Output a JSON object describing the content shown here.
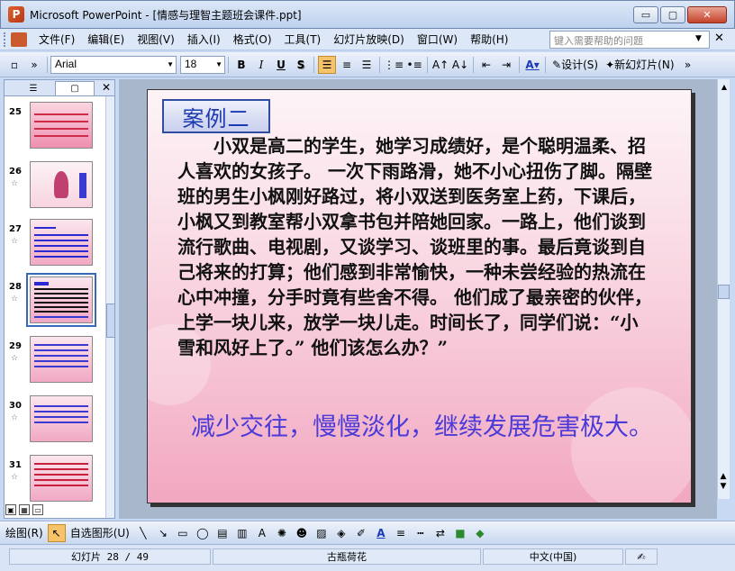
{
  "window": {
    "title": "Microsoft PowerPoint - [情感与理智主题班会课件.ppt]",
    "app_icon_letter": "P",
    "minimize_label": "▭",
    "restore_label": "▢",
    "close_label": "✕"
  },
  "menubar": {
    "items": [
      "文件(F)",
      "编辑(E)",
      "视图(V)",
      "插入(I)",
      "格式(O)",
      "工具(T)",
      "幻灯片放映(D)",
      "窗口(W)",
      "帮助(H)"
    ],
    "help_placeholder": "键入需要帮助的问题",
    "close_label": "✕"
  },
  "toolbar": {
    "font_name": "Arial",
    "font_size": "18",
    "bold": "B",
    "italic": "I",
    "underline": "U",
    "shadow": "S",
    "design_label": "设计(S)",
    "new_slide_label": "新幻灯片(N)"
  },
  "left_pane": {
    "tab_outline": "☰",
    "tab_slides": "▢",
    "close_label": "✕",
    "thumbnails": [
      {
        "num": "25",
        "star": "",
        "style": "pink-dots"
      },
      {
        "num": "26",
        "star": "☆",
        "style": "flowers"
      },
      {
        "num": "27",
        "star": "☆",
        "style": "blue-text"
      },
      {
        "num": "28",
        "star": "☆",
        "style": "blue-text",
        "selected": true
      },
      {
        "num": "29",
        "star": "☆",
        "style": "pink-text"
      },
      {
        "num": "30",
        "star": "☆",
        "style": "pink-text"
      },
      {
        "num": "31",
        "star": "☆",
        "style": "red-text"
      }
    ]
  },
  "slide": {
    "title": "案例二",
    "body": "小双是高二的学生，她学习成绩好，是个聪明温柔、招人喜欢的女孩子。 一次下雨路滑，她不小心扭伤了脚。隔壁班的男生小枫刚好路过，将小双送到医务室上药，下课后，小枫又到教室帮小双拿书包并陪她回家。一路上，他们谈到流行歌曲、电视剧，又谈学习、谈班里的事。最后竟谈到自己将来的打算；他们感到非常愉快，一种未尝经验的热流在心中冲撞，分手时竟有些舍不得。 他们成了最亲密的伙伴，上学一块儿来，放学一块儿走。时间长了，同学们说：“小雪和风好上了。” 他们该怎么办？”",
    "conclusion": "减少交往，慢慢淡化，继续发展危害极大。",
    "title_color": "#1d3bb0",
    "conclusion_color": "#4b3ad8"
  },
  "drawbar": {
    "draw_label": "绘图(R)",
    "autoshape_label": "自选图形(U)"
  },
  "statusbar": {
    "slide_count": "幻灯片 28 / 49",
    "template": "古瓶荷花",
    "language": "中文(中国)"
  }
}
